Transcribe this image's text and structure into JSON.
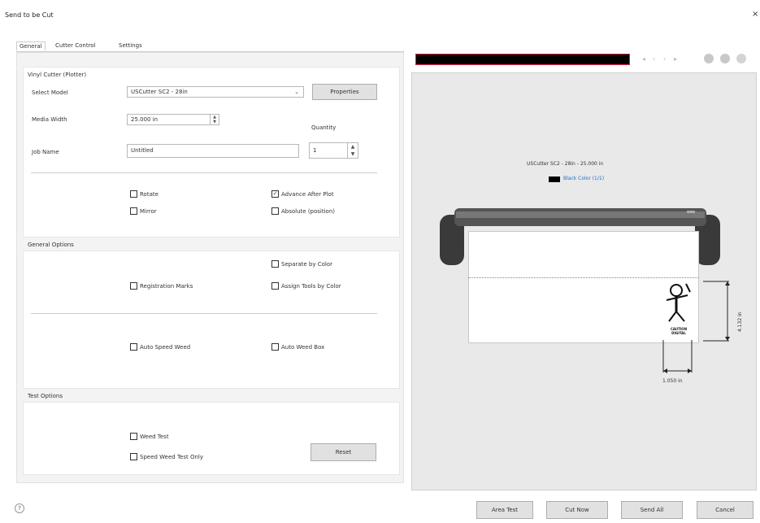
{
  "window": {
    "title": "Send to be Cut",
    "close_glyph": "×"
  },
  "tabs": [
    {
      "label": "General",
      "active": true
    },
    {
      "label": "Cutter Control",
      "active": false
    },
    {
      "label": "Settings",
      "active": false
    }
  ],
  "vinyl_cutter": {
    "group_title": "Vinyl Cutter (Plotter)",
    "select_model_label": "Select Model",
    "select_model_value": "USCutter SC2 - 28in",
    "properties_button": "Properties",
    "media_width_label": "Media Width",
    "media_width_value": "25.000 in",
    "quantity_label": "Quantity",
    "quantity_value": "1",
    "job_name_label": "Job Name",
    "job_name_value": "Untitled",
    "rotate_label": "Rotate",
    "mirror_label": "Mirror",
    "advance_after_plot_label": "Advance After Plot",
    "absolute_position_label": "Absolute (position)"
  },
  "general_options": {
    "group_title": "General Options",
    "separate_by_color_label": "Separate by Color",
    "registration_marks_label": "Registration Marks",
    "assign_tools_by_color_label": "Assign Tools by Color",
    "auto_speed_weed_label": "Auto Speed Weed",
    "auto_weed_box_label": "Auto Weed Box"
  },
  "test_options": {
    "group_title": "Test Options",
    "weed_test_label": "Weed Test",
    "speed_weed_test_only_label": "Speed Weed Test Only",
    "reset_button": "Reset"
  },
  "preview": {
    "cutter_caption": "USCutter SC2 - 28in - 25.000 in",
    "color_label": "Black Color (1/1)",
    "height_dim": "4.132 in",
    "width_dim": "1.050 in",
    "logo_text": "CAUTION DIGITAL"
  },
  "bottom": {
    "help_glyph": "?",
    "area_test": "Area Test",
    "cut_now": "Cut Now",
    "send_all": "Send All",
    "cancel": "Cancel"
  },
  "colors": {
    "accent_link": "#1a6fc9",
    "progress_bar": "#000000",
    "progress_border": "#dd2244"
  }
}
